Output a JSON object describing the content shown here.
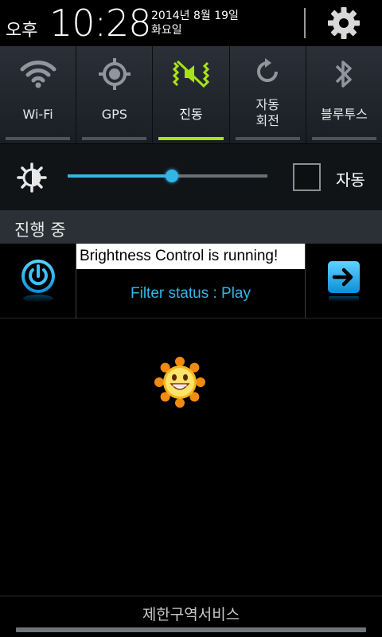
{
  "status": {
    "ampm": "오후",
    "time": "10:28",
    "date_line1": "2014년 8월 19일",
    "date_line2": "화요일"
  },
  "quick_toggles": [
    {
      "id": "wifi",
      "label": "Wi-Fi",
      "icon": "wifi-icon",
      "active": false
    },
    {
      "id": "gps",
      "label": "GPS",
      "icon": "gps-icon",
      "active": false
    },
    {
      "id": "vibrate",
      "label": "진동",
      "icon": "vibrate-icon",
      "active": true
    },
    {
      "id": "auto-rotate",
      "label_line1": "자동",
      "label_line2": "회전",
      "icon": "rotate-icon",
      "active": false
    },
    {
      "id": "bluetooth",
      "label": "블루투스",
      "icon": "bluetooth-icon",
      "active": false
    }
  ],
  "brightness": {
    "level": 0.52,
    "auto_label": "자동",
    "auto_checked": false
  },
  "ongoing": {
    "title": "진행 중"
  },
  "notification": {
    "title": "Brightness Control is running!",
    "status": "Filter status : Play"
  },
  "footer": {
    "carrier": "제한구역서비스"
  },
  "colors": {
    "accent": "#33b5e5",
    "active_toggle": "#a8e414",
    "panel": "#1c2127"
  }
}
